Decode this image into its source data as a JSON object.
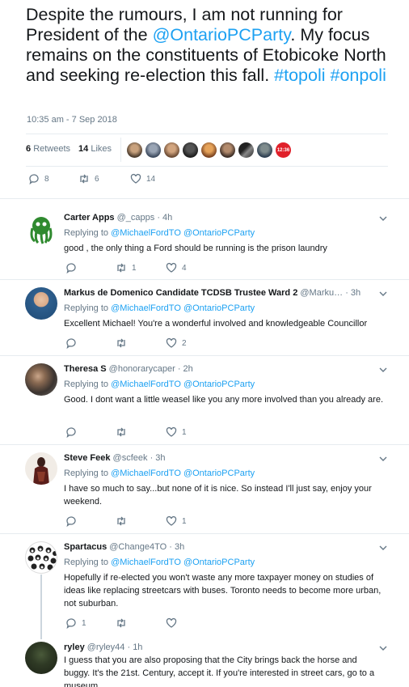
{
  "main": {
    "text_parts": {
      "p1": "Despite the rumours, I am not running for President of the ",
      "mention": "@OntarioPCParty",
      "p2": ". My focus remains on the constituents of Etobicoke North and seeking re-election this fall. ",
      "tag1": "#topoli",
      "tag2": "#onpoli"
    },
    "timestamp": "10:35 am - 7 Sep 2018",
    "retweets_count": "6",
    "retweets_label": "Retweets",
    "likes_count": "14",
    "likes_label": "Likes",
    "badge_text": "12:36",
    "actions": {
      "replies": "8",
      "retweets": "6",
      "likes": "14"
    }
  },
  "replies": [
    {
      "name": "Carter Apps",
      "handle": "@_capps",
      "time": "· 4h",
      "replying_label": "Replying to",
      "to1": "@MichaelFordTO",
      "to2": "@OntarioPCParty",
      "text": "good , the only thing a Ford should be running is the prison laundry",
      "replies": "",
      "retweets": "1",
      "likes": "4"
    },
    {
      "name": "Markus de Domenico Candidate TCDSB Trustee Ward 2",
      "handle": "@Marku…",
      "time": "· 3h",
      "replying_label": "Replying to",
      "to1": "@MichaelFordTO",
      "to2": "@OntarioPCParty",
      "text": "Excellent Michael! You're a wonderful involved and knowledgeable Councillor",
      "replies": "",
      "retweets": "",
      "likes": "2"
    },
    {
      "name": "Theresa S",
      "handle": "@honorarycaper",
      "time": "· 2h",
      "replying_label": "Replying to",
      "to1": "@MichaelFordTO",
      "to2": "@OntarioPCParty",
      "text": "Good. I dont want a little weasel like you any more involved than you already are.",
      "replies": "",
      "retweets": "",
      "likes": "1"
    },
    {
      "name": "Steve Feek",
      "handle": "@scfeek",
      "time": "· 3h",
      "replying_label": "Replying to",
      "to1": "@MichaelFordTO",
      "to2": "@OntarioPCParty",
      "text": "I have so much to say...but none of it is nice. So instead I'll just say, enjoy your weekend.",
      "replies": "",
      "retweets": "",
      "likes": "1"
    },
    {
      "name": "Spartacus",
      "handle": "@Change4TO",
      "time": "· 3h",
      "replying_label": "Replying to",
      "to1": "@MichaelFordTO",
      "to2": "@OntarioPCParty",
      "text": "Hopefully if re-elected you won't waste any more taxpayer money on studies of ideas like replacing streetcars with buses.  Toronto needs to become more urban, not suburban.",
      "replies": "1",
      "retweets": "",
      "likes": ""
    },
    {
      "name": "ryley",
      "handle": "@ryley44",
      "time": "· 1h",
      "text": "I guess that you are also proposing that the City brings back the horse and buggy. It's the 21st. Century, accept it. If you're interested in street cars, go to a museum."
    }
  ],
  "colors": {
    "accent": "#1da1f2",
    "muted": "#657786",
    "border": "#e6ecf0"
  }
}
